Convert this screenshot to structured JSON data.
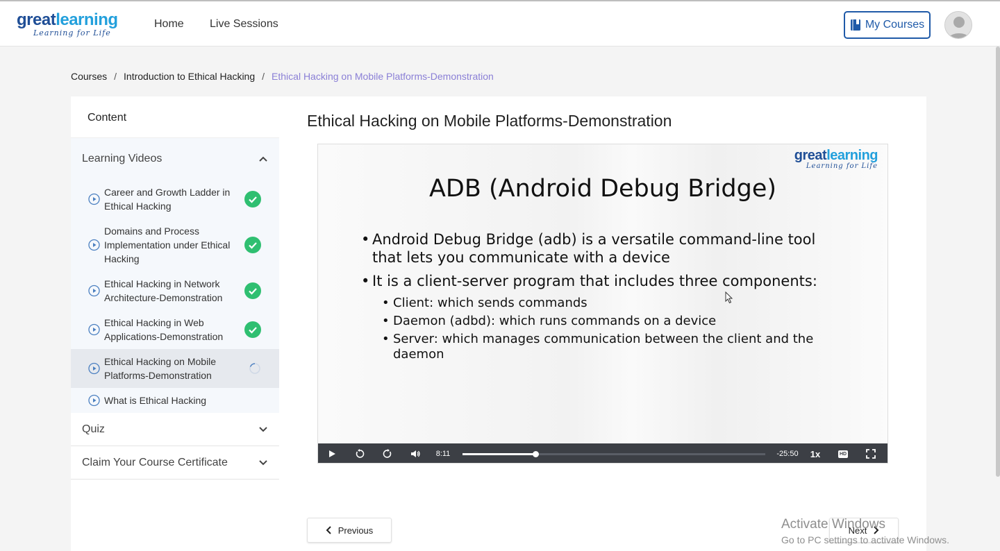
{
  "header": {
    "logo_great": "great",
    "logo_learning": "learning",
    "logo_tagline": "Learning for Life",
    "nav": [
      "Home",
      "Live Sessions"
    ],
    "my_courses": "My Courses"
  },
  "breadcrumb": {
    "items": [
      "Courses",
      "Introduction to Ethical Hacking"
    ],
    "separator": "/",
    "current": "Ethical Hacking on Mobile Platforms-Demonstration"
  },
  "sidebar": {
    "title": "Content",
    "sections": {
      "videos": "Learning Videos",
      "quiz": "Quiz",
      "certificate": "Claim Your Course Certificate"
    },
    "videos": [
      {
        "label": "Career and Growth Ladder in Ethical Hacking",
        "status": "completed"
      },
      {
        "label": "Domains and Process Implementation under Ethical Hacking",
        "status": "completed"
      },
      {
        "label": "Ethical Hacking in Network Architecture-Demonstration",
        "status": "completed"
      },
      {
        "label": "Ethical Hacking in Web Applications-Demonstration",
        "status": "completed"
      },
      {
        "label": "Ethical Hacking on Mobile Platforms-Demonstration",
        "status": "in-progress"
      },
      {
        "label": "What is Ethical Hacking",
        "status": "none"
      }
    ]
  },
  "main": {
    "title": "Ethical Hacking on Mobile Platforms-Demonstration",
    "prev_label": "Previous",
    "next_label": "Next"
  },
  "slide": {
    "logo_great": "great",
    "logo_learning": "learning",
    "logo_tagline": "Learning for Life",
    "title": "ADB (Android Debug Bridge)",
    "bullets": [
      "Android Debug Bridge (adb) is a versatile command-line tool that lets you communicate with a device",
      "It is a client-server program that includes three components:"
    ],
    "sub_bullets": [
      "Client: which sends commands",
      "Daemon (adbd): which runs commands on a device",
      "Server: which manages communication between the client and the daemon"
    ]
  },
  "player": {
    "elapsed": "8:11",
    "remaining": "-25:50",
    "playback_rate": "1x",
    "hd_label": "HD",
    "progress_fraction": 0.24
  },
  "watermark": {
    "title": "Activate Windows",
    "subtitle": "Go to PC settings to activate Windows."
  },
  "colors": {
    "brand_dark": "#1f4e96",
    "brand_light": "#23a0dc",
    "accent": "#5b6ee1",
    "complete_green": "#2fbf71",
    "breadcrumb_current": "#8a7fd6"
  }
}
